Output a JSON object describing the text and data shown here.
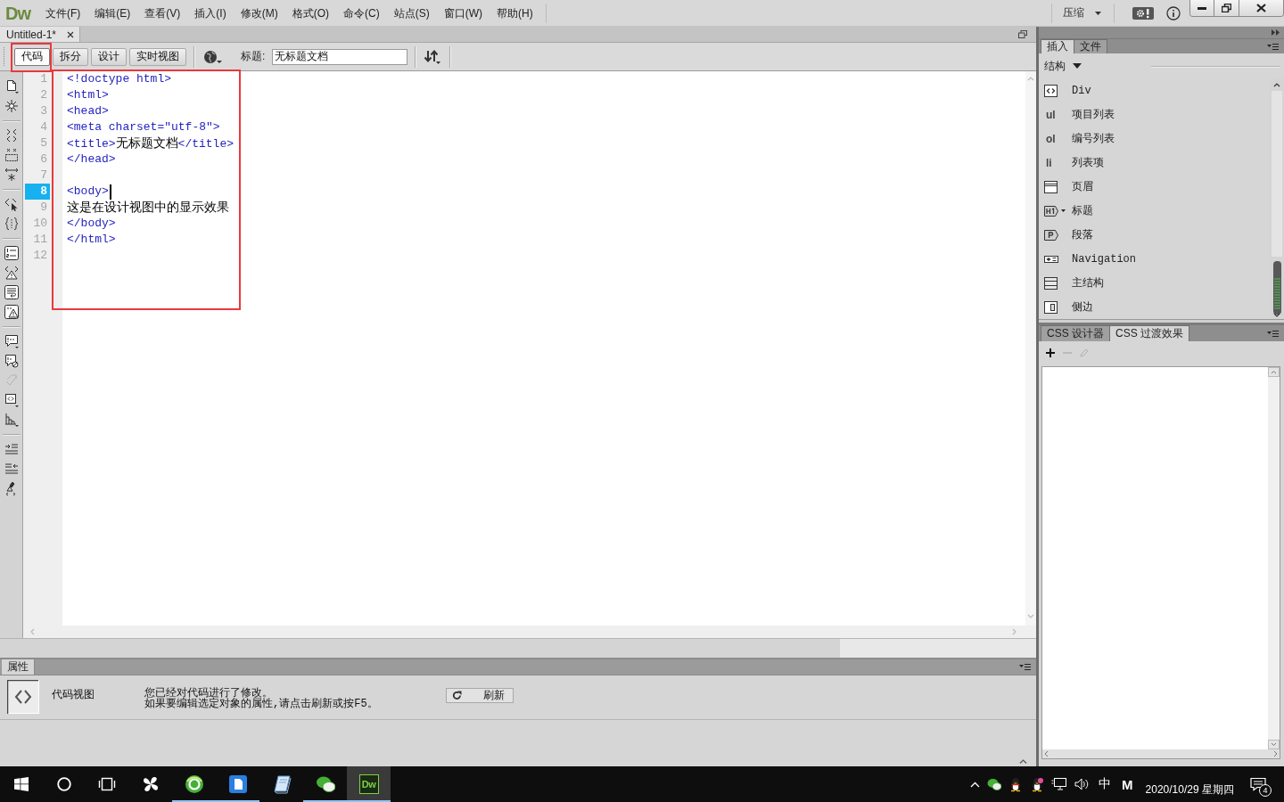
{
  "menu_bar": {
    "logo": "Dw",
    "menus": [
      "文件(F)",
      "编辑(E)",
      "查看(V)",
      "插入(I)",
      "修改(M)",
      "格式(O)",
      "命令(C)",
      "站点(S)",
      "窗口(W)",
      "帮助(H)"
    ],
    "workspace": "压缩"
  },
  "document_tabs": [
    {
      "label": "Untitled-1*",
      "selected": true
    }
  ],
  "document_toolbar": {
    "views": [
      {
        "label": "代码",
        "selected": true,
        "highlighted": true
      },
      {
        "label": "拆分",
        "selected": false,
        "highlighted": false
      },
      {
        "label": "设计",
        "selected": false,
        "highlighted": false
      },
      {
        "label": "实时视图",
        "selected": false,
        "highlighted": false
      }
    ],
    "title_label": "标题:",
    "title_value": "无标题文档"
  },
  "coding_toolbar": [
    {
      "tools": [
        {
          "kind": "file",
          "disabled": false
        },
        {
          "kind": "asterisk",
          "disabled": false
        }
      ]
    },
    {
      "tools": [
        {
          "kind": "collapsetag",
          "disabled": false
        },
        {
          "kind": "collapsesel",
          "disabled": false
        },
        {
          "kind": "expand",
          "disabled": false
        }
      ]
    },
    {
      "tools": [
        {
          "kind": "selectparent",
          "disabled": false
        },
        {
          "kind": "braces",
          "disabled": false
        }
      ]
    },
    {
      "tools": [
        {
          "kind": "linenumbers",
          "disabled": false
        },
        {
          "kind": "invalid",
          "disabled": false
        },
        {
          "kind": "wrap",
          "disabled": false
        },
        {
          "kind": "alerts",
          "disabled": false
        }
      ]
    },
    {
      "tools": [
        {
          "kind": "comment",
          "disabled": false
        },
        {
          "kind": "uncomment",
          "disabled": false
        },
        {
          "kind": "wraptag",
          "disabled": true
        },
        {
          "kind": "snippets",
          "disabled": false
        },
        {
          "kind": "movecss",
          "disabled": false
        }
      ]
    },
    {
      "tools": [
        {
          "kind": "indent",
          "disabled": false
        },
        {
          "kind": "outdent",
          "disabled": false
        },
        {
          "kind": "format",
          "disabled": false
        }
      ]
    }
  ],
  "editor": {
    "highlighted": true,
    "lines": [
      {
        "number": "1",
        "current": false,
        "tokens": [
          {
            "kind": "tag",
            "text": "<!doctype html>"
          }
        ]
      },
      {
        "number": "2",
        "current": false,
        "tokens": [
          {
            "kind": "tag",
            "text": "<html>"
          }
        ]
      },
      {
        "number": "3",
        "current": false,
        "tokens": [
          {
            "kind": "tag",
            "text": "<head>"
          }
        ]
      },
      {
        "number": "4",
        "current": false,
        "tokens": [
          {
            "kind": "tag",
            "text": "<meta charset=\"utf-8\">"
          }
        ]
      },
      {
        "number": "5",
        "current": false,
        "tokens": [
          {
            "kind": "tag",
            "text": "<title>"
          },
          {
            "kind": "text",
            "text": "无标题文档"
          },
          {
            "kind": "tag",
            "text": "</title>"
          }
        ]
      },
      {
        "number": "6",
        "current": false,
        "tokens": [
          {
            "kind": "tag",
            "text": "</head>"
          }
        ]
      },
      {
        "number": "7",
        "current": false
      },
      {
        "number": "8",
        "current": true,
        "tokens": [
          {
            "kind": "tag",
            "text": "<body>"
          }
        ]
      },
      {
        "number": "9",
        "current": false,
        "tokens": [
          {
            "kind": "text",
            "text": "这是在设计视图中的显示效果"
          }
        ]
      },
      {
        "number": "10",
        "current": false,
        "tokens": [
          {
            "kind": "tag",
            "text": "</body>"
          }
        ]
      },
      {
        "number": "11",
        "current": false,
        "tokens": [
          {
            "kind": "tag",
            "text": "</html>"
          }
        ]
      },
      {
        "number": "12",
        "current": false
      }
    ]
  },
  "properties": {
    "tab": "属性",
    "view_name": "代码视图",
    "message": [
      "您已经对代码进行了修改。",
      "如果要编辑选定对象的属性,请点击刷新或按F5。"
    ],
    "refresh_button": "刷新"
  },
  "insert_panel": {
    "tabs": [
      {
        "label": "插入",
        "selected": true
      },
      {
        "label": "文件",
        "selected": false
      }
    ],
    "category": "结构",
    "items": [
      {
        "kind": "div",
        "label": "Div",
        "has_dropdown": false
      },
      {
        "kind": "text",
        "icon_text": "ul",
        "label": "项目列表",
        "has_dropdown": false
      },
      {
        "kind": "text",
        "icon_text": "ol",
        "label": "编号列表",
        "has_dropdown": false
      },
      {
        "kind": "text",
        "icon_text": "li",
        "label": "列表项",
        "has_dropdown": false
      },
      {
        "kind": "header",
        "label": "页眉",
        "has_dropdown": false
      },
      {
        "kind": "heading",
        "label": "标题",
        "has_dropdown": true
      },
      {
        "kind": "paragraph",
        "label": "段落",
        "has_dropdown": false
      },
      {
        "kind": "nav",
        "label": "Navigation",
        "has_dropdown": false
      },
      {
        "kind": "main",
        "label": "主结构",
        "has_dropdown": false
      },
      {
        "kind": "aside",
        "label": "侧边",
        "has_dropdown": false
      }
    ]
  },
  "css_panel": {
    "tabs": [
      {
        "label": "CSS 设计器",
        "selected": false
      },
      {
        "label": "CSS 过渡效果",
        "selected": true
      }
    ],
    "tools": [
      {
        "kind": "add",
        "disabled": false
      },
      {
        "kind": "remove",
        "disabled": true
      },
      {
        "kind": "edit",
        "disabled": true
      }
    ]
  },
  "taskbar": {
    "apps": [
      {
        "kind": "pinwheel",
        "running": false,
        "selected": false
      },
      {
        "kind": "globe",
        "running": true,
        "selected": false
      },
      {
        "kind": "document",
        "running": true,
        "selected": false
      },
      {
        "kind": "notebook",
        "running": false,
        "selected": false
      },
      {
        "kind": "chat",
        "running": true,
        "selected": false
      },
      {
        "kind": "tile",
        "label": "Dw",
        "running": true,
        "selected": true
      }
    ],
    "ime": "中",
    "ime_mode": "M",
    "date": "2020/10/29 星期四",
    "notifications": "4"
  }
}
